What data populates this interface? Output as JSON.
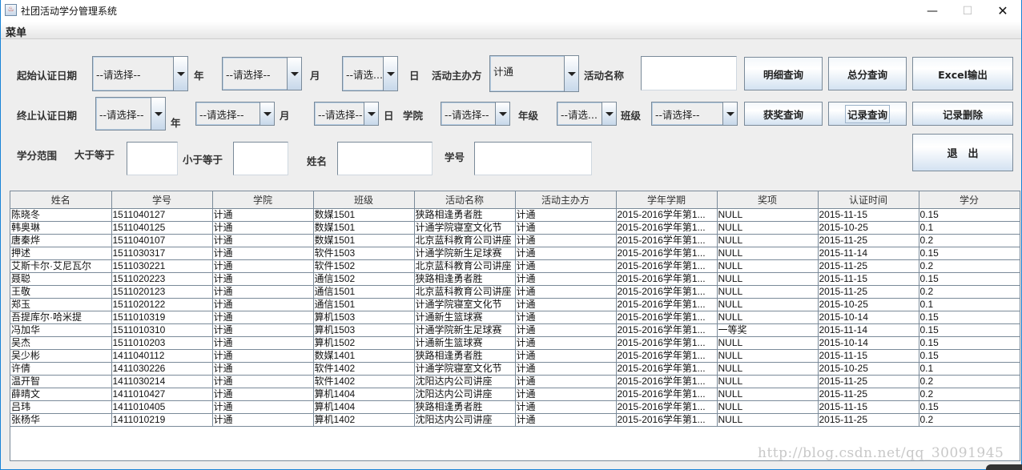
{
  "window": {
    "title": "社团活动学分管理系统",
    "icon": "java-icon",
    "controls": {
      "minimize": "—",
      "maximize": "☐",
      "close": "✕"
    }
  },
  "menubar": {
    "menu_label": "菜单"
  },
  "filters": {
    "start_date": {
      "label": "起始认证日期",
      "year": "--请选择--",
      "year_unit": "年",
      "month": "--请选择--",
      "month_unit": "月",
      "day": "--请选...",
      "day_unit": "日"
    },
    "organizer": {
      "label": "活动主办方",
      "value": "计通"
    },
    "activity_name": {
      "label": "活动名称",
      "value": ""
    },
    "end_date": {
      "label": "终止认证日期",
      "year": "--请选择--",
      "year_unit": "年",
      "month": "--请选择--",
      "month_unit": "月",
      "day": "--请选择--",
      "day_unit": "日"
    },
    "college": {
      "label": "学院",
      "value": "--请选择--"
    },
    "grade": {
      "label": "年级",
      "value": "--请选..."
    },
    "class": {
      "label": "班级",
      "value": "--请选择--"
    },
    "credit_range": {
      "label": "学分范围",
      "gte_label": "大于等于",
      "gte_value": "",
      "lte_label": "小于等于",
      "lte_value": ""
    },
    "name": {
      "label": "姓名",
      "value": ""
    },
    "student_id": {
      "label": "学号",
      "value": ""
    }
  },
  "buttons": {
    "detail_query": "明细查询",
    "total_query": "总分查询",
    "excel_export": "Excel输出",
    "award_query": "获奖查询",
    "record_query": "记录查询",
    "record_delete": "记录删除",
    "exit": "退　出"
  },
  "table": {
    "columns": [
      "姓名",
      "学号",
      "学院",
      "班级",
      "活动名称",
      "活动主办方",
      "学年学期",
      "奖项",
      "认证时间",
      "学分"
    ],
    "rows": [
      [
        "陈晓冬",
        "1511040127",
        "计通",
        "数媒1501",
        "狭路相逢勇者胜",
        "计通",
        "2015-2016学年第1...",
        "NULL",
        "2015-11-15",
        "0.15"
      ],
      [
        "韩奥琳",
        "1511040125",
        "计通",
        "数媒1501",
        "计通学院寝室文化节",
        "计通",
        "2015-2016学年第1...",
        "NULL",
        "2015-10-25",
        "0.1"
      ],
      [
        "唐秦烨",
        "1511040107",
        "计通",
        "数媒1501",
        "北京蓝科教育公司讲座",
        "计通",
        "2015-2016学年第1...",
        "NULL",
        "2015-11-25",
        "0.2"
      ],
      [
        "押述",
        "1511030317",
        "计通",
        "软件1503",
        "计通学院新生足球赛",
        "计通",
        "2015-2016学年第1...",
        "NULL",
        "2015-11-14",
        "0.15"
      ],
      [
        "艾斯卡尔·艾尼瓦尔",
        "1511030221",
        "计通",
        "软件1502",
        "北京蓝科教育公司讲座",
        "计通",
        "2015-2016学年第1...",
        "NULL",
        "2015-11-25",
        "0.2"
      ],
      [
        "聂聪",
        "1511020223",
        "计通",
        "通信1502",
        "狭路相逢勇者胜",
        "计通",
        "2015-2016学年第1...",
        "NULL",
        "2015-11-15",
        "0.15"
      ],
      [
        "王敬",
        "1511020123",
        "计通",
        "通信1501",
        "北京蓝科教育公司讲座",
        "计通",
        "2015-2016学年第1...",
        "NULL",
        "2015-11-25",
        "0.2"
      ],
      [
        "郑玉",
        "1511020122",
        "计通",
        "通信1501",
        "计通学院寝室文化节",
        "计通",
        "2015-2016学年第1...",
        "NULL",
        "2015-10-25",
        "0.1"
      ],
      [
        "吾提库尔·哈米提",
        "1511010319",
        "计通",
        "算机1503",
        "计通新生篮球赛",
        "计通",
        "2015-2016学年第1...",
        "NULL",
        "2015-10-14",
        "0.15"
      ],
      [
        "冯加华",
        "1511010310",
        "计通",
        "算机1503",
        "计通学院新生足球赛",
        "计通",
        "2015-2016学年第1...",
        "一等奖",
        "2015-11-14",
        "0.15"
      ],
      [
        "吴杰",
        "1511010203",
        "计通",
        "算机1502",
        "计通新生篮球赛",
        "计通",
        "2015-2016学年第1...",
        "NULL",
        "2015-10-14",
        "0.15"
      ],
      [
        "吴少彬",
        "1411040112",
        "计通",
        "数媒1401",
        "狭路相逢勇者胜",
        "计通",
        "2015-2016学年第1...",
        "NULL",
        "2015-11-15",
        "0.15"
      ],
      [
        "许倩",
        "1411030226",
        "计通",
        "软件1402",
        "计通学院寝室文化节",
        "计通",
        "2015-2016学年第1...",
        "NULL",
        "2015-10-25",
        "0.1"
      ],
      [
        "温开智",
        "1411030214",
        "计通",
        "软件1402",
        "沈阳达内公司讲座",
        "计通",
        "2015-2016学年第1...",
        "NULL",
        "2015-11-25",
        "0.2"
      ],
      [
        "薛晴文",
        "1411010427",
        "计通",
        "算机1404",
        "沈阳达内公司讲座",
        "计通",
        "2015-2016学年第1...",
        "NULL",
        "2015-11-25",
        "0.2"
      ],
      [
        "吕玮",
        "1411010405",
        "计通",
        "算机1404",
        "狭路相逢勇者胜",
        "计通",
        "2015-2016学年第1...",
        "NULL",
        "2015-11-15",
        "0.15"
      ],
      [
        "张杨华",
        "1411010219",
        "计通",
        "算机1402",
        "沈阳达内公司讲座",
        "计通",
        "2015-2016学年第1...",
        "NULL",
        "2015-11-25",
        "0.2"
      ]
    ]
  },
  "watermark": "http://blog.csdn.net/qq_30091945"
}
